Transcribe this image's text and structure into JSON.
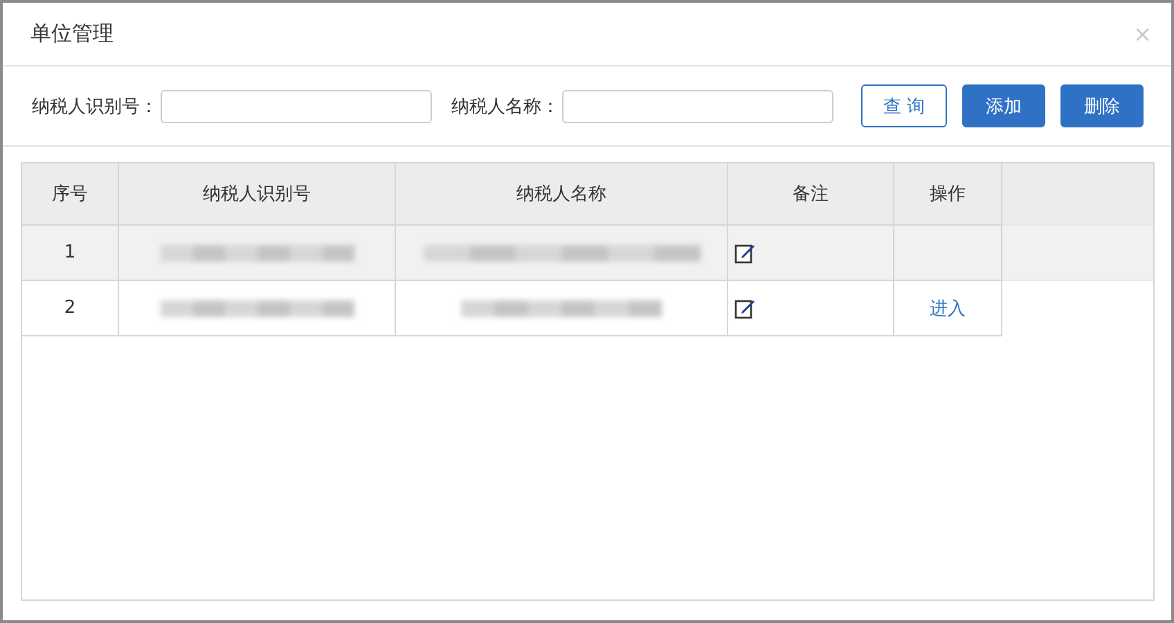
{
  "window": {
    "title": "单位管理",
    "close": "×"
  },
  "filters": [
    {
      "label": "纳税人识别号："
    },
    {
      "label": "纳税人名称："
    }
  ],
  "buttons": [
    {
      "label": "查 询",
      "kind": "outline"
    },
    {
      "label": "添加",
      "kind": "primary"
    },
    {
      "label": "删除",
      "kind": "primary"
    }
  ],
  "table": {
    "columns": [
      "序号",
      "纳税人识别号",
      "纳税人名称",
      "备注",
      "操作"
    ],
    "rows": [
      {
        "index": "1",
        "selected": true
      },
      {
        "index": "2",
        "selected": false,
        "action": "进入"
      }
    ]
  }
}
